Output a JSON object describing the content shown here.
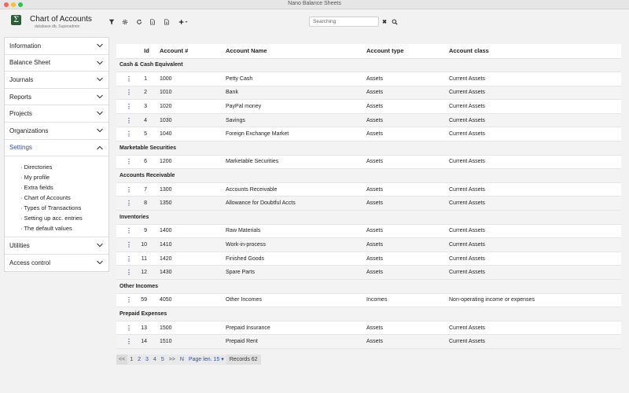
{
  "window": {
    "title": "Nano Balance Sheets"
  },
  "header": {
    "logo_glyph": "Σ",
    "title": "Chart of Accounts",
    "subtitle": "database.db, Superadmin",
    "toolbar_icons": [
      "filter-icon",
      "gear-icon",
      "refresh-icon",
      "document-icon",
      "export-icon",
      "add-icon"
    ],
    "search": {
      "placeholder": "Searching",
      "value": ""
    },
    "clear_glyph": "✖"
  },
  "sidebar": {
    "items": [
      {
        "label": "Information"
      },
      {
        "label": "Balance Sheet"
      },
      {
        "label": "Journals"
      },
      {
        "label": "Reports"
      },
      {
        "label": "Projects"
      },
      {
        "label": "Organizations"
      },
      {
        "label": "Settings"
      },
      {
        "label": "Utilities"
      },
      {
        "label": "Access control"
      }
    ],
    "settings_sub": [
      "· Directories",
      "· My profile",
      "· Extra fields",
      "· Chart of Accounts",
      "· Types of Transactions",
      "· Setting up acc. entries",
      "· The default values"
    ]
  },
  "table": {
    "columns": [
      "",
      "Id",
      "Account #",
      "Account Name",
      "Account type",
      "Account class"
    ],
    "groups": [
      {
        "name": "Cash & Cash Equivalent",
        "rows": [
          {
            "id": "1",
            "acc": "1000",
            "name": "Petty Cash",
            "type": "Assets",
            "class": "Current Assets"
          },
          {
            "id": "2",
            "acc": "1010",
            "name": "Bank",
            "type": "Assets",
            "class": "Current Assets"
          },
          {
            "id": "3",
            "acc": "1020",
            "name": "PayPal money",
            "type": "Assets",
            "class": "Current Assets"
          },
          {
            "id": "4",
            "acc": "1030",
            "name": "Savings",
            "type": "Assets",
            "class": "Current Assets"
          },
          {
            "id": "5",
            "acc": "1040",
            "name": "Foreign Exchange Market",
            "type": "Assets",
            "class": "Current Assets"
          }
        ]
      },
      {
        "name": "Marketable Securities",
        "rows": [
          {
            "id": "6",
            "acc": "1200",
            "name": "Marketable Securities",
            "type": "Assets",
            "class": "Current Assets"
          }
        ]
      },
      {
        "name": "Accounts Receivable",
        "rows": [
          {
            "id": "7",
            "acc": "1300",
            "name": "Accounts Receivable",
            "type": "Assets",
            "class": "Current Assets"
          },
          {
            "id": "8",
            "acc": "1350",
            "name": "Allowance for Doubtful Accts",
            "type": "Assets",
            "class": "Current Assets"
          }
        ]
      },
      {
        "name": "Inventories",
        "rows": [
          {
            "id": "9",
            "acc": "1400",
            "name": "Raw Materials",
            "type": "Assets",
            "class": "Current Assets"
          },
          {
            "id": "10",
            "acc": "1410",
            "name": "Work-in-process",
            "type": "Assets",
            "class": "Current Assets"
          },
          {
            "id": "11",
            "acc": "1420",
            "name": "Finished Goods",
            "type": "Assets",
            "class": "Current Assets"
          },
          {
            "id": "12",
            "acc": "1430",
            "name": "Spare Parts",
            "type": "Assets",
            "class": "Current Assets"
          }
        ]
      },
      {
        "name": "Other Incomes",
        "rows": [
          {
            "id": "59",
            "acc": "4050",
            "name": "Other Incomes",
            "type": "Incomes",
            "class": "Non-operating income or expenses"
          }
        ]
      },
      {
        "name": "Prepaid Expenses",
        "rows": [
          {
            "id": "13",
            "acc": "1500",
            "name": "Prepaid Insurance",
            "type": "Assets",
            "class": "Current Assets"
          },
          {
            "id": "14",
            "acc": "1510",
            "name": "Prepaid Rent",
            "type": "Assets",
            "class": "Current Assets"
          }
        ]
      }
    ]
  },
  "pager": {
    "first": "<<",
    "pages": [
      "1",
      "2",
      "3",
      "4",
      "5"
    ],
    "next": ">>",
    "n": "N",
    "page_len": "Page len. 15",
    "records": "Records 62"
  },
  "colors": {
    "accent": "#2f4ea8",
    "link": "#2f5fc8",
    "logo_bg": "#2b5d37"
  }
}
